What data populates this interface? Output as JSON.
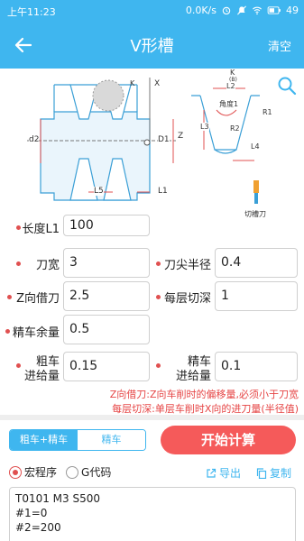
{
  "status_bar": {
    "time": "上午11:23",
    "network_speed": "0.0K/s",
    "battery": "49"
  },
  "header": {
    "title": "V形槽",
    "clear_label": "清空"
  },
  "diagram": {
    "left_labels": {
      "k": "K",
      "x": "X",
      "z": "Z",
      "d2": "d2",
      "d1": "D1",
      "l5": "L5",
      "l1": "L1"
    },
    "right_labels": {
      "k": "K",
      "k_sub": "(B)",
      "l2": "L2",
      "angle": "角度1",
      "r1": "R1",
      "r2": "R2",
      "l3": "L3",
      "l4": "L4"
    },
    "tool_label": "切槽刀"
  },
  "form": {
    "length_l1": {
      "label": "长度L1",
      "value": "100"
    },
    "blade_width": {
      "label": "刀宽",
      "value": "3"
    },
    "tip_radius": {
      "label": "刀尖半径",
      "value": "0.4"
    },
    "z_offset": {
      "label": "Z向借刀",
      "value": "2.5"
    },
    "cut_depth": {
      "label": "每层切深",
      "value": "1"
    },
    "finish_allowance": {
      "label": "精车余量",
      "value": "0.5"
    },
    "rough_feed": {
      "label_1": "粗车",
      "label_2": "进给量",
      "value": "0.15"
    },
    "finish_feed": {
      "label_1": "精车",
      "label_2": "进给量",
      "value": "0.1"
    }
  },
  "notes": {
    "line_1": "Z向借刀:Z向车削时的偏移量,必须小于刀宽",
    "line_2": "每层切深:单层车削时X向的进刀量(半径值)"
  },
  "mode": {
    "option_1": "粗车+精车",
    "option_2": "精车"
  },
  "start_label": "开始计算",
  "output": {
    "macro_label": "宏程序",
    "gcode_label": "G代码",
    "export_label": "导出",
    "copy_label": "复制"
  },
  "code_lines": [
    "T0101 M3 S500",
    "#1=0",
    "#2=200"
  ],
  "colors": {
    "primary": "#3fb6ef",
    "accent_red": "#f55a5a",
    "note_red": "#e64545"
  }
}
